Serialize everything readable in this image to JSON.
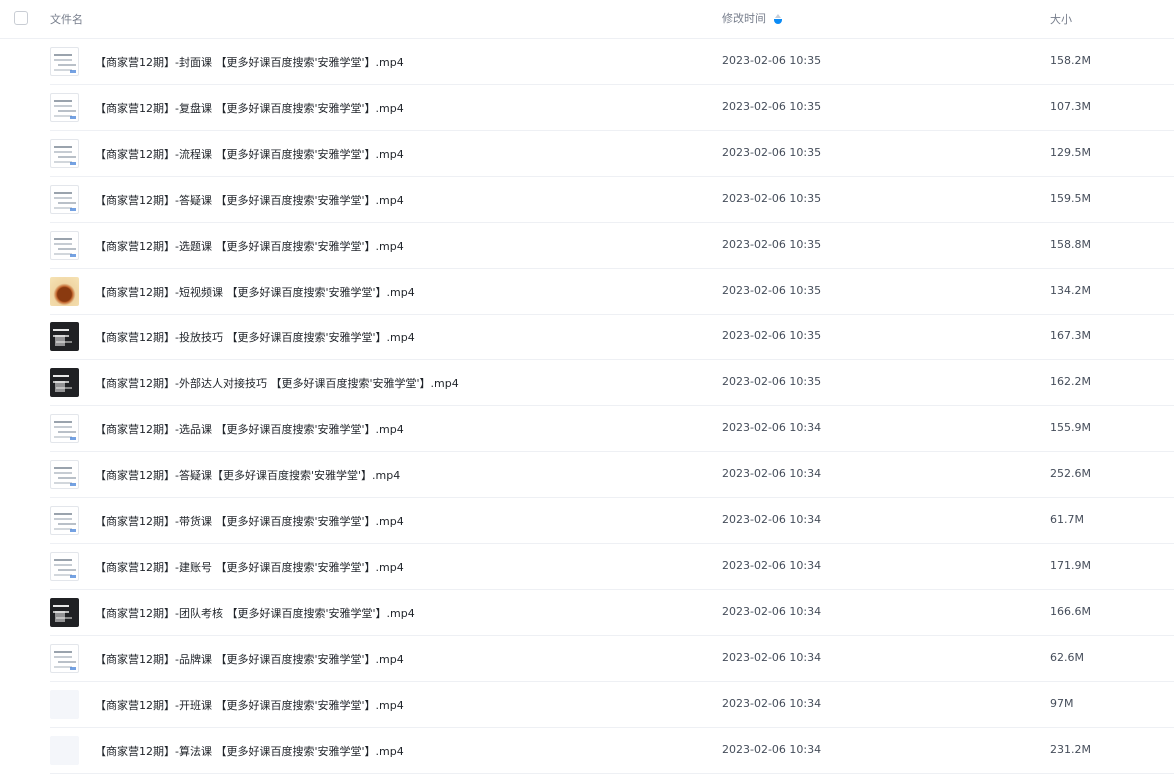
{
  "header": {
    "name_label": "文件名",
    "time_label": "修改时间",
    "size_label": "大小",
    "sort_icon": "sort-descending-icon",
    "sort_accent": "#0b8bf5"
  },
  "files": [
    {
      "name": "【商家营12期】-封面课 【更多好课百度搜索'安雅学堂'】.mp4",
      "time": "2023-02-06 10:35",
      "size": "158.2M",
      "thumb": "light"
    },
    {
      "name": "【商家营12期】-复盘课 【更多好课百度搜索'安雅学堂'】.mp4",
      "time": "2023-02-06 10:35",
      "size": "107.3M",
      "thumb": "light"
    },
    {
      "name": "【商家营12期】-流程课 【更多好课百度搜索'安雅学堂'】.mp4",
      "time": "2023-02-06 10:35",
      "size": "129.5M",
      "thumb": "light"
    },
    {
      "name": "【商家营12期】-答疑课 【更多好课百度搜索'安雅学堂'】.mp4",
      "time": "2023-02-06 10:35",
      "size": "159.5M",
      "thumb": "light"
    },
    {
      "name": "【商家营12期】-选题课 【更多好课百度搜索'安雅学堂'】.mp4",
      "time": "2023-02-06 10:35",
      "size": "158.8M",
      "thumb": "light"
    },
    {
      "name": "【商家营12期】-短视频课 【更多好课百度搜索'安雅学堂'】.mp4",
      "time": "2023-02-06 10:35",
      "size": "134.2M",
      "thumb": "food"
    },
    {
      "name": "【商家营12期】-投放技巧 【更多好课百度搜索'安雅学堂'】.mp4",
      "time": "2023-02-06 10:35",
      "size": "167.3M",
      "thumb": "dark"
    },
    {
      "name": "【商家营12期】-外部达人对接技巧 【更多好课百度搜索'安雅学堂'】.mp4",
      "time": "2023-02-06 10:35",
      "size": "162.2M",
      "thumb": "dark"
    },
    {
      "name": "【商家营12期】-选品课 【更多好课百度搜索'安雅学堂'】.mp4",
      "time": "2023-02-06 10:34",
      "size": "155.9M",
      "thumb": "light"
    },
    {
      "name": "【商家营12期】-答疑课【更多好课百度搜索'安雅学堂'】.mp4",
      "time": "2023-02-06 10:34",
      "size": "252.6M",
      "thumb": "light"
    },
    {
      "name": "【商家营12期】-带货课 【更多好课百度搜索'安雅学堂'】.mp4",
      "time": "2023-02-06 10:34",
      "size": "61.7M",
      "thumb": "light"
    },
    {
      "name": "【商家营12期】-建账号 【更多好课百度搜索'安雅学堂'】.mp4",
      "time": "2023-02-06 10:34",
      "size": "171.9M",
      "thumb": "light"
    },
    {
      "name": "【商家营12期】-团队考核 【更多好课百度搜索'安雅学堂'】.mp4",
      "time": "2023-02-06 10:34",
      "size": "166.6M",
      "thumb": "dark"
    },
    {
      "name": "【商家营12期】-品牌课 【更多好课百度搜索'安雅学堂'】.mp4",
      "time": "2023-02-06 10:34",
      "size": "62.6M",
      "thumb": "light"
    },
    {
      "name": "【商家营12期】-开班课 【更多好课百度搜索'安雅学堂'】.mp4",
      "time": "2023-02-06 10:34",
      "size": "97M",
      "thumb": "blank"
    },
    {
      "name": "【商家营12期】-算法课 【更多好课百度搜索'安雅学堂'】.mp4",
      "time": "2023-02-06 10:34",
      "size": "231.2M",
      "thumb": "blank"
    }
  ]
}
